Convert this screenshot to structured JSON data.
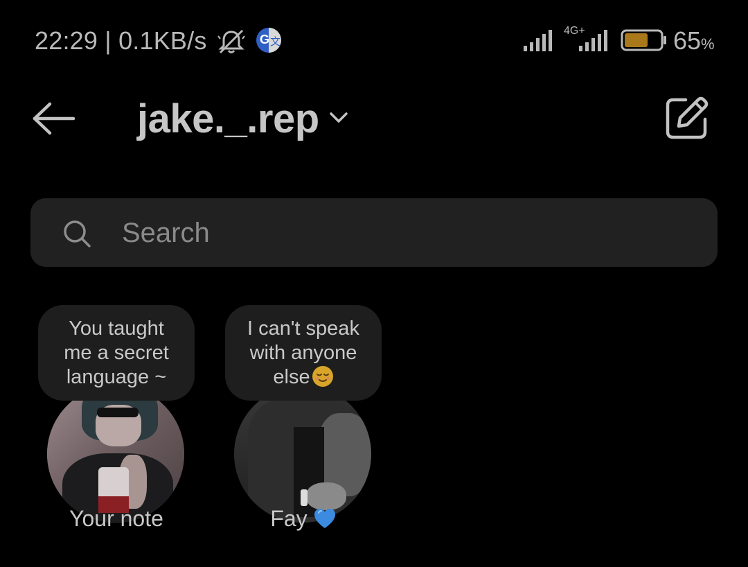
{
  "status_bar": {
    "time": "22:29",
    "separator": "|",
    "speed": "0.1KB/s",
    "network_label": "4G+",
    "battery_percent": "65",
    "battery_unit": "%",
    "battery_level": 0.65,
    "battery_color": "#a8781a"
  },
  "header": {
    "username": "jake._.rep"
  },
  "search": {
    "placeholder": "Search"
  },
  "notes": [
    {
      "note_text": "You taught\nme a secret\nlanguage ~",
      "name": "Your note"
    },
    {
      "note_text": "I can't speak\nwith anyone\nelse",
      "note_emoji": "relieved-face",
      "name": "Fay",
      "name_emoji": "blue-heart"
    }
  ],
  "colors": {
    "background": "#000000",
    "search_bg": "#212121",
    "bubble_bg": "#1e1e1e",
    "text": "#c8c8c8",
    "heart": "#3b8be0"
  }
}
